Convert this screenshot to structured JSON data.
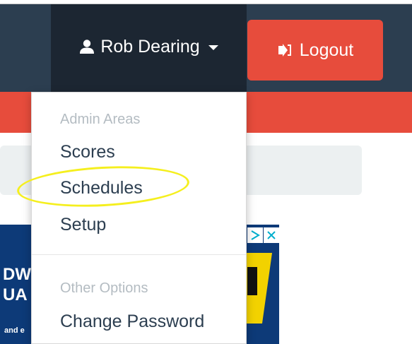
{
  "navbar": {
    "user_name": "Rob Dearing",
    "user_icon": "user-icon",
    "caret_icon": "caret-down-icon",
    "logout_label": "Logout",
    "logout_icon": "sign-out-icon"
  },
  "dropdown": {
    "admin_header": "Admin Areas",
    "admin_items": [
      "Scores",
      "Schedules",
      "Setup"
    ],
    "other_header": "Other Options",
    "other_items": [
      "Change Password"
    ]
  },
  "ad": {
    "line1": "DW",
    "line2": "UA",
    "line3": "and e"
  },
  "colors": {
    "navbar": "#2c3e50",
    "navbar_active": "#1c2632",
    "danger": "#e74c3c",
    "highlight": "#f5ef1e",
    "muted": "#b4bcc2",
    "text": "#2c3e50",
    "ad_choices": "#00aecd"
  }
}
